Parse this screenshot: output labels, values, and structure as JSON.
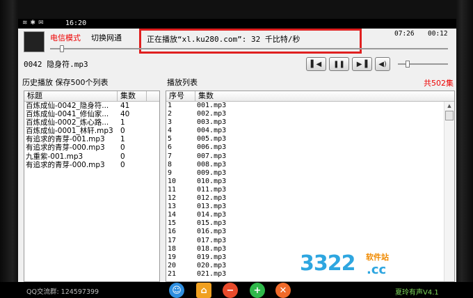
{
  "statusbar": {
    "time": "16:20",
    "icons": [
      "wifi-icon",
      "bluetooth-icon",
      "mail-icon"
    ]
  },
  "header": {
    "mode_label": "电信模式",
    "switch_label": "切换网通",
    "now_playing": "正在播放“xl.ku280.com”: 32 千比特/秒",
    "elapsed": "07:26",
    "total": "00:12"
  },
  "progress": {
    "position_fraction": 0.03
  },
  "volume": {
    "level_fraction": 0.2
  },
  "current_track": "0042 隐身符.mp3",
  "controls": {
    "prev": "previous-icon",
    "pause": "pause-icon",
    "next": "next-icon",
    "volume": "speaker-icon"
  },
  "history": {
    "title": "历史播放 保存500个列表",
    "columns": [
      "标题",
      "集数"
    ],
    "rows": [
      {
        "title": "百炼成仙-0042_隐身符...",
        "count": "41"
      },
      {
        "title": "百炼成仙-0041_修仙家...",
        "count": "40"
      },
      {
        "title": "百炼成仙-0002_炼心路...",
        "count": "1"
      },
      {
        "title": "百炼成仙-0001_林轩.mp3",
        "count": "0"
      },
      {
        "title": "有追求的青芽-001.mp3",
        "count": "1"
      },
      {
        "title": "有追求的青芽-000.mp3",
        "count": "0"
      },
      {
        "title": "九重紫-001.mp3",
        "count": "0"
      },
      {
        "title": "有追求的青芽-000.mp3",
        "count": "0"
      }
    ]
  },
  "playlist": {
    "title": "播放列表",
    "count_label": "共502集",
    "columns": [
      "序号",
      "集数"
    ],
    "rows": [
      {
        "no": "1",
        "name": "001.mp3"
      },
      {
        "no": "2",
        "name": "002.mp3"
      },
      {
        "no": "3",
        "name": "003.mp3"
      },
      {
        "no": "4",
        "name": "004.mp3"
      },
      {
        "no": "5",
        "name": "005.mp3"
      },
      {
        "no": "6",
        "name": "006.mp3"
      },
      {
        "no": "7",
        "name": "007.mp3"
      },
      {
        "no": "8",
        "name": "008.mp3"
      },
      {
        "no": "9",
        "name": "009.mp3"
      },
      {
        "no": "10",
        "name": "010.mp3"
      },
      {
        "no": "11",
        "name": "011.mp3"
      },
      {
        "no": "12",
        "name": "012.mp3"
      },
      {
        "no": "13",
        "name": "013.mp3"
      },
      {
        "no": "14",
        "name": "014.mp3"
      },
      {
        "no": "15",
        "name": "015.mp3"
      },
      {
        "no": "16",
        "name": "016.mp3"
      },
      {
        "no": "17",
        "name": "017.mp3"
      },
      {
        "no": "18",
        "name": "018.mp3"
      },
      {
        "no": "19",
        "name": "019.mp3"
      },
      {
        "no": "20",
        "name": "020.mp3"
      },
      {
        "no": "21",
        "name": "021.mp3"
      }
    ]
  },
  "watermark": {
    "number": "3322",
    "domain": ".cc",
    "subtitle": "软件站"
  },
  "footer": {
    "qq_group": "QQ交流群: 124597399",
    "version": "夏玲有声V4.1",
    "icons": [
      "user-icon",
      "home-icon",
      "minus-icon",
      "plus-icon",
      "close-icon"
    ]
  },
  "colors": {
    "accent_red": "#e02020",
    "version_green": "#7fd85b",
    "watermark_blue": "#2ea6e0"
  }
}
